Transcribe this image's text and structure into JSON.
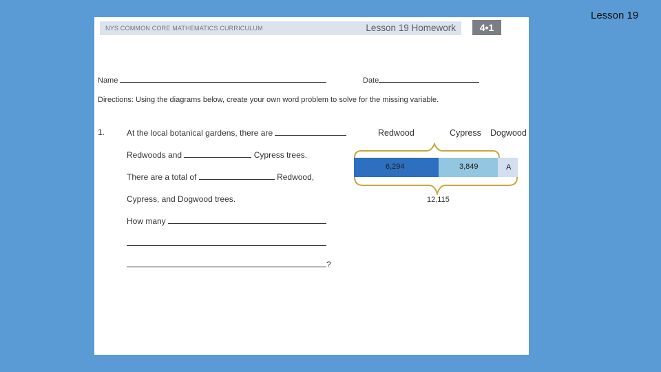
{
  "corner_label": "Lesson 19",
  "header": {
    "curriculum": "NYS COMMON CORE MATHEMATICS CURRICULUM",
    "lesson_title": "Lesson 19 Homework",
    "module_badge": "4•1"
  },
  "fields": {
    "name_label": "Name",
    "date_label": "Date"
  },
  "directions": "Directions: Using the diagrams below, create your own word problem to solve for the missing variable.",
  "problem": {
    "number": "1.",
    "line1": "At the local botanical gardens, there are",
    "line2a": "Redwoods and",
    "line2b": "Cypress trees.",
    "line3a": "There are a total of",
    "line3b": "Redwood,",
    "line4": "Cypress, and Dogwood trees.",
    "line5": "How many",
    "end_mark": "?"
  },
  "tape_diagram": {
    "labels": [
      "Redwood",
      "Cypress",
      "Dogwood"
    ],
    "segments": [
      {
        "label": "6,294",
        "color": "#2e6fbf"
      },
      {
        "label": "3,849",
        "color": "#93c6e0"
      },
      {
        "label": "A",
        "color": "#d3def0"
      }
    ],
    "total": "12,115"
  }
}
